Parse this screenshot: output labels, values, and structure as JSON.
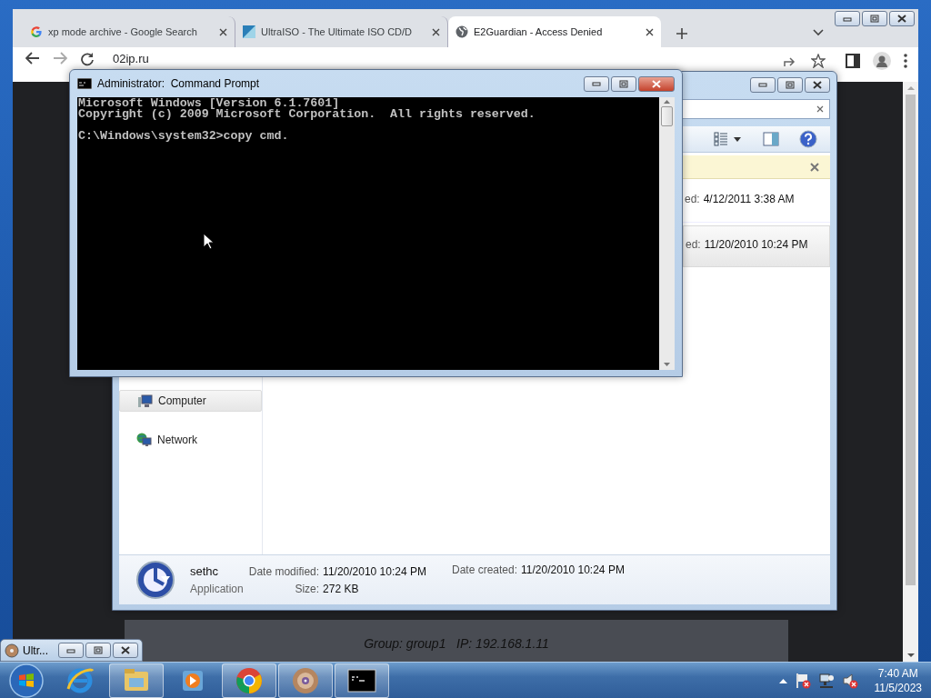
{
  "browser": {
    "tabs": [
      {
        "kind": "google",
        "title": "xp mode archive - Google Search",
        "selected": false
      },
      {
        "kind": "ultraiso",
        "title": "UltraISO - The Ultimate ISO CD/D",
        "selected": false
      },
      {
        "kind": "globe",
        "title": "E2Guardian - Access Denied",
        "selected": true
      }
    ],
    "address": "02ip.ru",
    "page_text": "Group: group1   IP: 192.168.1.11"
  },
  "explorer": {
    "files": [
      {
        "date_label": "ed:",
        "date": "4/12/2011 3:38 AM",
        "selected": false
      },
      {
        "date_label": "ed:",
        "date": "11/20/2010 10:24 PM",
        "selected": true
      }
    ],
    "nav": [
      {
        "kind": "computer",
        "label": "Computer",
        "selected": true
      },
      {
        "kind": "network",
        "label": "Network",
        "selected": false
      }
    ],
    "details": {
      "name": "sethc",
      "type": "Application",
      "modified_label": "Date modified:",
      "modified": "11/20/2010 10:24 PM",
      "size_label": "Size:",
      "size": "272 KB",
      "created_label": "Date created:",
      "created": "11/20/2010 10:24 PM"
    }
  },
  "console": {
    "title": "Administrator:  Command Prompt",
    "lines": [
      {
        "text": "Microsoft Windows [Version 6.1.7601]",
        "gap_before": false
      },
      {
        "text": "Copyright (c) 2009 Microsoft Corporation.  All rights reserved.",
        "gap_before": false
      },
      {
        "text": "C:\\Windows\\system32>copy cmd.",
        "gap_before": true
      }
    ]
  },
  "minimized": {
    "title": "Ultr..."
  },
  "taskbar": {
    "apps": [
      {
        "kind": "ie",
        "running": false
      },
      {
        "kind": "explorer",
        "running": true
      },
      {
        "kind": "media",
        "running": false
      },
      {
        "kind": "chrome",
        "running": true
      },
      {
        "kind": "disc",
        "running": true
      },
      {
        "kind": "cmd",
        "running": true
      }
    ],
    "clock": {
      "time": "7:40 AM",
      "date": "11/5/2023"
    }
  }
}
